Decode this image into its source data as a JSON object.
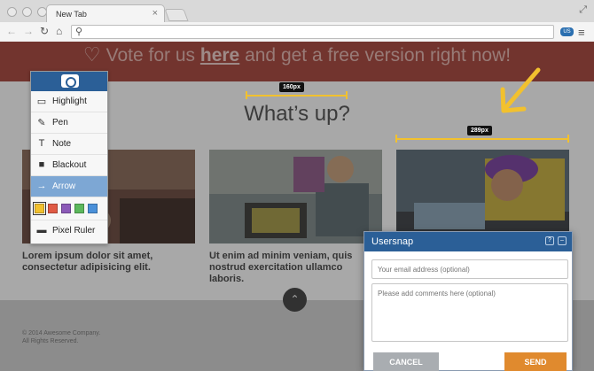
{
  "browser": {
    "tab_title": "New Tab",
    "tab_close": "×",
    "resize_icon": "⤢",
    "back_icon": "←",
    "forward_icon": "→",
    "reload_icon": "↻",
    "home_icon": "⌂",
    "search_icon": "⚲",
    "menu_icon": "≡",
    "extension_label": "US"
  },
  "banner": {
    "text_before": "Vote for us ",
    "link": "here",
    "text_after": " and get a free version right now!",
    "heart_icon": "♡"
  },
  "page": {
    "heading": "What’s up?",
    "captions": [
      "Lorem ipsum dolor sit amet, consectetur adipisicing elit.",
      "Ut enim ad minim veniam, quis nostrud exercitation ullamco laboris."
    ],
    "footer_line1": "© 2014 Awesome Company.",
    "footer_line2": "All Rights Reserved.",
    "scroll_top_icon": "⌃"
  },
  "measurements": [
    {
      "label": "160px"
    },
    {
      "label": "289px"
    }
  ],
  "tools": {
    "items": [
      {
        "label": "Highlight",
        "icon": "▭"
      },
      {
        "label": "Pen",
        "icon": "✎"
      },
      {
        "label": "Note",
        "icon": "T"
      },
      {
        "label": "Blackout",
        "icon": "■"
      },
      {
        "label": "Arrow",
        "icon": "→",
        "active": true
      },
      {
        "label": "Pixel Ruler",
        "icon": "▬"
      }
    ],
    "colors": [
      "#f2c12e",
      "#e05a44",
      "#8c5ab8",
      "#5cb85c",
      "#4a90d9"
    ]
  },
  "dialog": {
    "title": "Usersnap",
    "help_icon": "?",
    "minimize_icon": "–",
    "email_placeholder": "Your email address (optional)",
    "comment_placeholder": "Please add comments here (optional)",
    "cancel_label": "CANCEL",
    "send_label": "SEND"
  },
  "colors": {
    "banner_red": "#a8453b",
    "brand_blue": "#2b5f97",
    "send_orange": "#e08a2e",
    "cancel_gray": "#a9adb1",
    "annotation_yellow": "#f2c12e"
  }
}
